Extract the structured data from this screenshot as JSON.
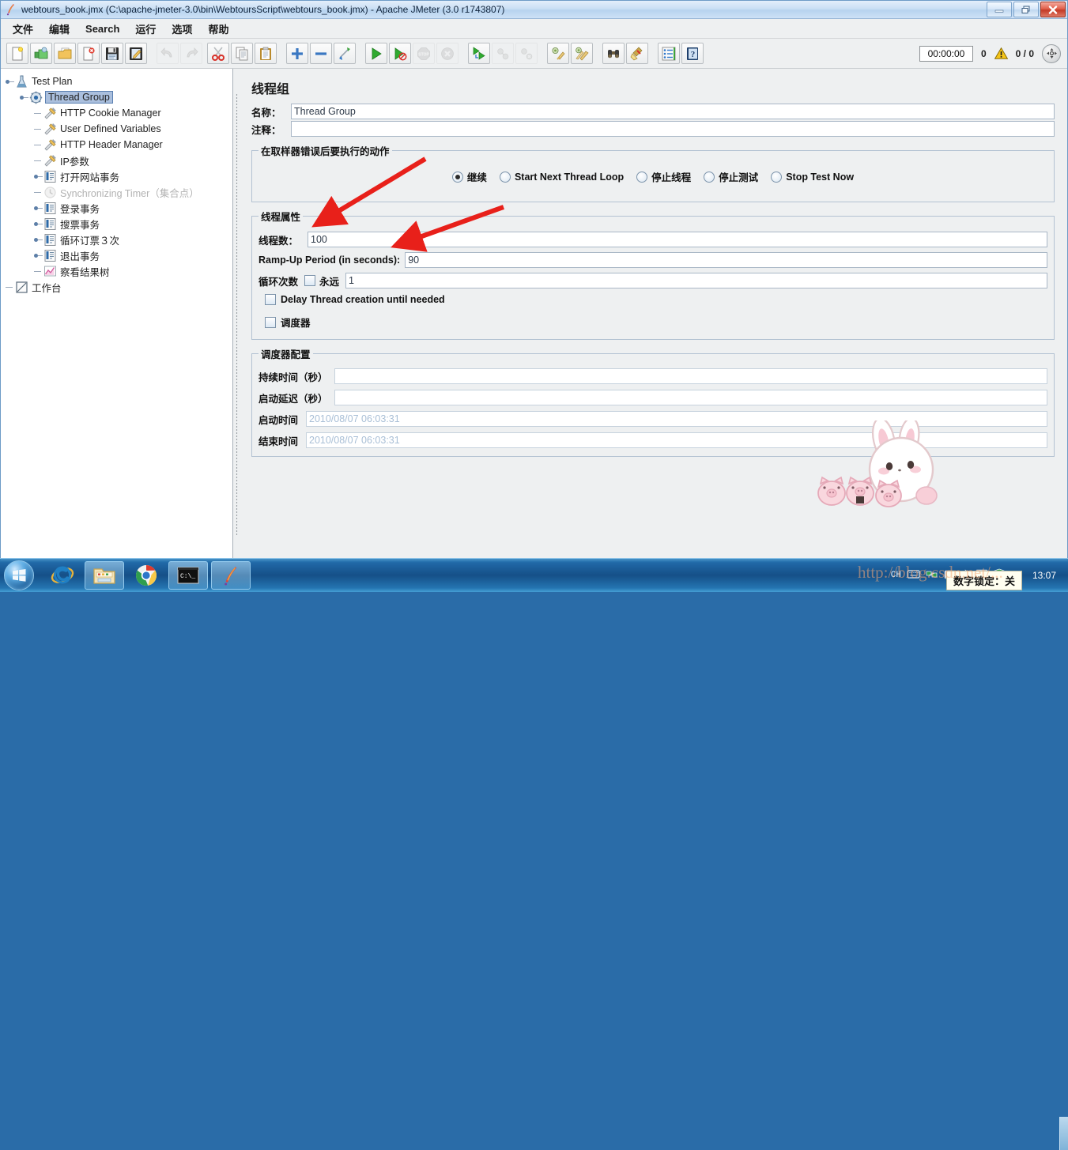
{
  "window": {
    "title": "webtours_book.jmx (C:\\apache-jmeter-3.0\\bin\\WebtoursScript\\webtours_book.jmx) - Apache JMeter (3.0 r1743807)",
    "app_icon": "jmeter-feather-icon",
    "buttons": {
      "minimize": "–",
      "maximize": "❐",
      "close": "✕"
    }
  },
  "menubar": {
    "items": [
      {
        "label": "文件",
        "name": "menu-file"
      },
      {
        "label": "编辑",
        "name": "menu-edit"
      },
      {
        "label": "Search",
        "name": "menu-search"
      },
      {
        "label": "运行",
        "name": "menu-run"
      },
      {
        "label": "选项",
        "name": "menu-options"
      },
      {
        "label": "帮助",
        "name": "menu-help"
      }
    ]
  },
  "toolbar": {
    "buttons": [
      {
        "icon": "new-file-icon",
        "enabled": true
      },
      {
        "icon": "templates-icon",
        "enabled": true
      },
      {
        "icon": "open-folder-icon",
        "enabled": true
      },
      {
        "icon": "close-file-icon",
        "enabled": true
      },
      {
        "icon": "save-icon",
        "enabled": true
      },
      {
        "icon": "save-as-icon",
        "enabled": true
      },
      {
        "icon": "undo-icon",
        "enabled": false
      },
      {
        "icon": "redo-icon",
        "enabled": false
      },
      {
        "icon": "cut-scissors-icon",
        "enabled": true
      },
      {
        "icon": "copy-icon",
        "enabled": true
      },
      {
        "icon": "paste-clipboard-icon",
        "enabled": true
      },
      {
        "icon": "expand-all-plus-icon",
        "enabled": true
      },
      {
        "icon": "collapse-all-minus-icon",
        "enabled": true
      },
      {
        "icon": "toggle-enable-icon",
        "enabled": true
      },
      {
        "icon": "start-play-icon",
        "enabled": true
      },
      {
        "icon": "start-no-pauses-icon",
        "enabled": true
      },
      {
        "icon": "stop-icon",
        "enabled": false
      },
      {
        "icon": "shutdown-icon",
        "enabled": false
      },
      {
        "icon": "remote-start-all-icon",
        "enabled": true
      },
      {
        "icon": "remote-stop-all-icon",
        "enabled": false
      },
      {
        "icon": "remote-shutdown-all-icon",
        "enabled": false
      },
      {
        "icon": "clear-icon",
        "enabled": true
      },
      {
        "icon": "clear-all-icon",
        "enabled": true
      },
      {
        "icon": "search-binoculars-icon",
        "enabled": true
      },
      {
        "icon": "reset-search-broom-icon",
        "enabled": true
      },
      {
        "icon": "function-helper-icon",
        "enabled": true
      },
      {
        "icon": "help-book-icon",
        "enabled": true
      }
    ],
    "timer": "00:00:00",
    "error_count": "0",
    "warning_icon": "warning-triangle-icon",
    "thread_count": "0 / 0",
    "expand_icon": "expand-arrows-icon"
  },
  "tree": {
    "nodes": [
      {
        "label": "Test Plan",
        "icon": "test-plan-icon",
        "depth": 0,
        "knob": "expanded",
        "selected": false,
        "dim": false
      },
      {
        "label": "Thread Group",
        "icon": "thread-group-icon",
        "depth": 1,
        "knob": "expanded",
        "selected": true,
        "dim": false
      },
      {
        "label": "HTTP Cookie Manager",
        "icon": "config-element-icon",
        "depth": 2,
        "knob": "leaf",
        "selected": false,
        "dim": false
      },
      {
        "label": "User Defined Variables",
        "icon": "config-element-icon",
        "depth": 2,
        "knob": "leaf",
        "selected": false,
        "dim": false
      },
      {
        "label": "HTTP Header Manager",
        "icon": "config-element-icon",
        "depth": 2,
        "knob": "leaf",
        "selected": false,
        "dim": false
      },
      {
        "label": "IP参数",
        "icon": "config-element-icon",
        "depth": 2,
        "knob": "leaf",
        "selected": false,
        "dim": false
      },
      {
        "label": "打开网站事务",
        "icon": "transaction-controller-icon",
        "depth": 2,
        "knob": "collapsed",
        "selected": false,
        "dim": false
      },
      {
        "label": "Synchronizing Timer（集合点）",
        "icon": "timer-icon",
        "depth": 2,
        "knob": "leaf",
        "selected": false,
        "dim": true
      },
      {
        "label": "登录事务",
        "icon": "transaction-controller-icon",
        "depth": 2,
        "knob": "collapsed",
        "selected": false,
        "dim": false
      },
      {
        "label": "搜票事务",
        "icon": "transaction-controller-icon",
        "depth": 2,
        "knob": "collapsed",
        "selected": false,
        "dim": false
      },
      {
        "label": "循环订票３次",
        "icon": "transaction-controller-icon",
        "depth": 2,
        "knob": "collapsed",
        "selected": false,
        "dim": false
      },
      {
        "label": "退出事务",
        "icon": "transaction-controller-icon",
        "depth": 2,
        "knob": "collapsed",
        "selected": false,
        "dim": false
      },
      {
        "label": "察看结果树",
        "icon": "view-results-tree-icon",
        "depth": 2,
        "knob": "leaf",
        "selected": false,
        "dim": false
      },
      {
        "label": "工作台",
        "icon": "workbench-icon",
        "depth": 0,
        "knob": "leaf",
        "selected": false,
        "dim": false
      }
    ]
  },
  "panel": {
    "title": "线程组",
    "name_label": "名称：",
    "name_value": "Thread Group",
    "comment_label": "注释：",
    "comment_value": "",
    "on_error": {
      "legend": "在取样器错误后要执行的动作",
      "options": [
        {
          "label": "继续",
          "selected": true
        },
        {
          "label": "Start Next Thread Loop",
          "selected": false
        },
        {
          "label": "停止线程",
          "selected": false
        },
        {
          "label": "停止测试",
          "selected": false
        },
        {
          "label": "Stop Test Now",
          "selected": false
        }
      ]
    },
    "thread_props": {
      "legend": "线程属性",
      "num_threads_label": "线程数：",
      "num_threads_value": "100",
      "ramp_up_label": "Ramp-Up Period (in seconds):",
      "ramp_up_value": "90",
      "loop_label": "循环次数",
      "forever_label": "永远",
      "forever_checked": false,
      "loop_value": "1",
      "delay_create_label": "Delay Thread creation until needed",
      "delay_create_checked": false,
      "scheduler_label": "调度器",
      "scheduler_checked": false
    },
    "scheduler": {
      "legend": "调度器配置",
      "duration_label": "持续时间（秒）",
      "duration_value": "",
      "startup_delay_label": "启动延迟（秒）",
      "startup_delay_value": "",
      "start_time_label": "启动时间",
      "start_time_value": "2010/08/07 06:03:31",
      "end_time_label": "结束时间",
      "end_time_value": "2010/08/07 06:03:31"
    }
  },
  "annotations": [
    {
      "name": "arrow-to-num-threads",
      "target": "num_threads_value"
    },
    {
      "name": "arrow-to-ramp-up",
      "target": "ramp_up_value"
    }
  ],
  "taskbar": {
    "start_icon": "windows-start-orb-icon",
    "apps": [
      {
        "icon": "internet-explorer-icon",
        "pinned": true,
        "running": false
      },
      {
        "icon": "file-explorer-icon",
        "pinned": true,
        "running": true
      },
      {
        "icon": "google-chrome-icon",
        "pinned": true,
        "running": false
      },
      {
        "icon": "command-prompt-icon",
        "pinned": false,
        "running": true
      },
      {
        "icon": "jmeter-feather-icon",
        "pinned": false,
        "running": true
      }
    ],
    "tray": {
      "input_method": "CH",
      "icons": [
        "keyboard-icon",
        "network-icon",
        "action-center-warning-icon",
        "bluetooth-icon",
        "display-icon",
        "security-shield-ok-icon",
        "volume-icon"
      ],
      "clock": "13:07",
      "numlock_tip": "数字锁定：关"
    }
  },
  "watermark": {
    "text": "http://blog.csdn.net/..."
  },
  "colors": {
    "accent": "#2b6ca8",
    "selection": "#aabfdd",
    "panel_bg": "#eef0f1",
    "annotation_red": "#e8201a",
    "placeholder": "#a9bfd6"
  }
}
